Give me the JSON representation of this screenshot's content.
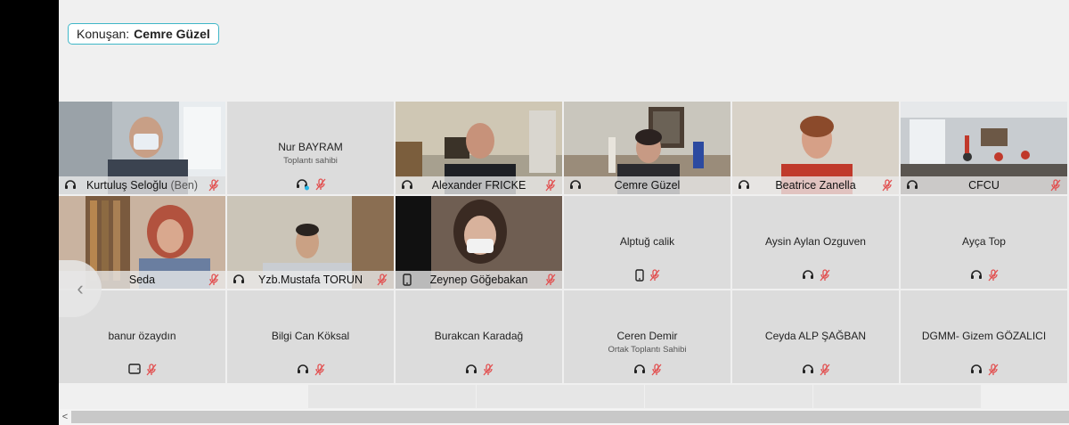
{
  "speaker": {
    "label": "Konuşan:",
    "name": "Cemre Güzel"
  },
  "colors": {
    "accent": "#29b6e6",
    "muted_red": "#e25050",
    "tile_bg": "#dcdcdc"
  },
  "tiles": [
    {
      "name": "Kurtuluş Seloğlu",
      "suffix": "(Ben)",
      "status_icon": "headset-icon"
    },
    {
      "name": "Nur BAYRAM",
      "role": "Toplantı sahibi",
      "status_icon": "headset-connected-icon"
    },
    {
      "name": "Alexander FRICKE",
      "status_icon": "headset-icon"
    },
    {
      "name": "Cemre Güzel",
      "status_icon": "headset-icon",
      "active": true
    },
    {
      "name": "Beatrice Zanella",
      "status_icon": "headset-icon"
    },
    {
      "name": "CFCU",
      "status_icon": "headset-icon"
    },
    {
      "name": "Seda"
    },
    {
      "name": "Yzb.Mustafa TORUN",
      "status_icon": "headset-icon"
    },
    {
      "name": "Zeynep Göğebakan",
      "status_icon": "phone-icon"
    },
    {
      "name": "Alptuğ calik",
      "status_icon": "phone-icon"
    },
    {
      "name": "Aysin Aylan Ozguven",
      "status_icon": "headset-icon"
    },
    {
      "name": "Ayça Top",
      "status_icon": "headset-icon"
    },
    {
      "name": "banur özaydın",
      "status_icon": "tablet-icon"
    },
    {
      "name": "Bilgi Can Köksal",
      "status_icon": "headset-icon"
    },
    {
      "name": "Burakcan Karadağ",
      "status_icon": "headset-icon"
    },
    {
      "name": "Ceren Demir",
      "role": "Ortak Toplantı Sahibi",
      "status_icon": "headset-icon"
    },
    {
      "name": "Ceyda ALP ŞAĞBAN",
      "status_icon": "headset-icon"
    },
    {
      "name": "DGMM- Gizem GÖZALICI",
      "status_icon": "headset-icon"
    }
  ],
  "nav": {
    "prev_glyph": "‹"
  },
  "scrollbar": {
    "left_arrow": "<"
  }
}
